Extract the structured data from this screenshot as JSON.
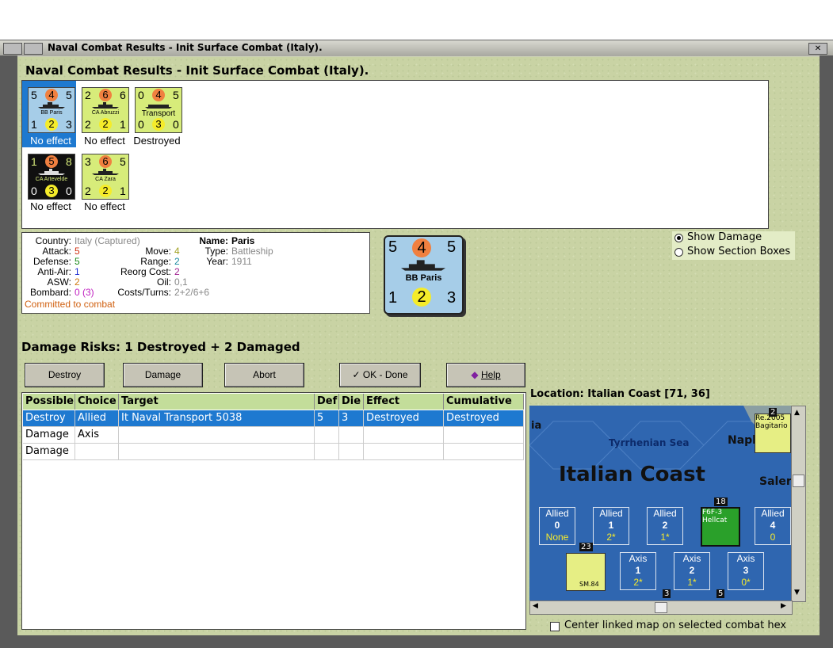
{
  "window": {
    "title": "Naval Combat Results - Init Surface Combat (Italy)."
  },
  "heading": "Naval Combat Results - Init Surface Combat (Italy).",
  "units": [
    {
      "name": "BB Paris",
      "top": [
        "5",
        "4",
        "5"
      ],
      "bottom": [
        "1",
        "2",
        "3"
      ],
      "result": "No effect",
      "bg": "#a6cde8",
      "selected": true
    },
    {
      "name": "CA Abruzzi",
      "top": [
        "2",
        "6",
        "6"
      ],
      "bottom": [
        "2",
        "2",
        "1"
      ],
      "result": "No effect",
      "bg": "#d7ec7a"
    },
    {
      "name": "Transport",
      "top": [
        "0",
        "4",
        "5"
      ],
      "bottom": [
        "0",
        "3",
        "0"
      ],
      "result": "Destroyed",
      "bg": "#d7ec7a"
    },
    {
      "name": "CA Artevelde",
      "top": [
        "1",
        "5",
        "8"
      ],
      "bottom": [
        "0",
        "3",
        "0"
      ],
      "result": "No effect",
      "bg": "#101010"
    },
    {
      "name": "CA Zara",
      "top": [
        "3",
        "6",
        "5"
      ],
      "bottom": [
        "2",
        "2",
        "1"
      ],
      "result": "No effect",
      "bg": "#d7ec7a"
    }
  ],
  "info": {
    "country_label": "Country:",
    "country": "Italy (Captured)",
    "attack_label": "Attack:",
    "attack": "5",
    "defense_label": "Defense:",
    "defense": "5",
    "antiair_label": "Anti-Air:",
    "antiair": "1",
    "asw_label": "ASW:",
    "asw": "2",
    "bombard_label": "Bombard:",
    "bombard": "0 (3)",
    "committed": "Committed to combat",
    "move_label": "Move:",
    "move": "4",
    "range_label": "Range:",
    "range": "2",
    "reorg_label": "Reorg Cost:",
    "reorg": "2",
    "oil_label": "Oil:",
    "oil": "0,1",
    "costs_label": "Costs/Turns:",
    "costs": "2+2/6+6",
    "name_label": "Name:",
    "name": "Paris",
    "type_label": "Type:",
    "type": "Battleship",
    "year_label": "Year:",
    "year": "1911"
  },
  "big_counter": {
    "top": [
      "5",
      "4",
      "5"
    ],
    "name": "BB Paris",
    "bottom": [
      "1",
      "2",
      "3"
    ]
  },
  "options": {
    "show_damage": "Show Damage",
    "show_sections": "Show Section Boxes"
  },
  "damage_risks": "Damage Risks:  1 Destroyed + 2 Damaged",
  "buttons": {
    "destroy": "Destroy",
    "damage": "Damage",
    "abort": "Abort",
    "ok": "OK - Done",
    "help": "Help"
  },
  "table": {
    "headers": [
      "Possible",
      "Choice",
      "Target",
      "Def",
      "Die",
      "Effect",
      "Cumulative"
    ],
    "rows": [
      [
        "Destroy",
        "Allied",
        "It Naval Transport 5038",
        "5",
        "3",
        "Destroyed",
        "Destroyed"
      ],
      [
        "Damage",
        "Axis",
        "",
        "",
        "",
        "",
        ""
      ],
      [
        "Damage",
        "",
        "",
        "",
        "",
        "",
        ""
      ]
    ]
  },
  "location": "Location:  Italian Coast [71, 36]",
  "map": {
    "title": "Italian Coast",
    "sea": "Tyrrhenian Sea",
    "ia": "ia",
    "napl": "Napl",
    "saler": "Saler",
    "allied_label": "Allied",
    "axis_label": "Axis",
    "allied_zones": [
      [
        "0",
        "None"
      ],
      [
        "1",
        "2*"
      ],
      [
        "2",
        "1*"
      ],
      [
        "4",
        "0"
      ]
    ],
    "axis_zones": [
      [
        "1",
        "2*"
      ],
      [
        "2",
        "1*"
      ],
      [
        "3",
        "0*"
      ]
    ],
    "stack_counts": [
      "2",
      "18",
      "23",
      "3",
      "5"
    ],
    "counter_re2005": "Re.2005",
    "counter_bagitario": "Bagitario",
    "counter_f6f": "F6F-3",
    "counter_hellcat": "Hellcat",
    "counter_sm84": "SM.84"
  },
  "center_map": "Center linked map on selected combat hex"
}
